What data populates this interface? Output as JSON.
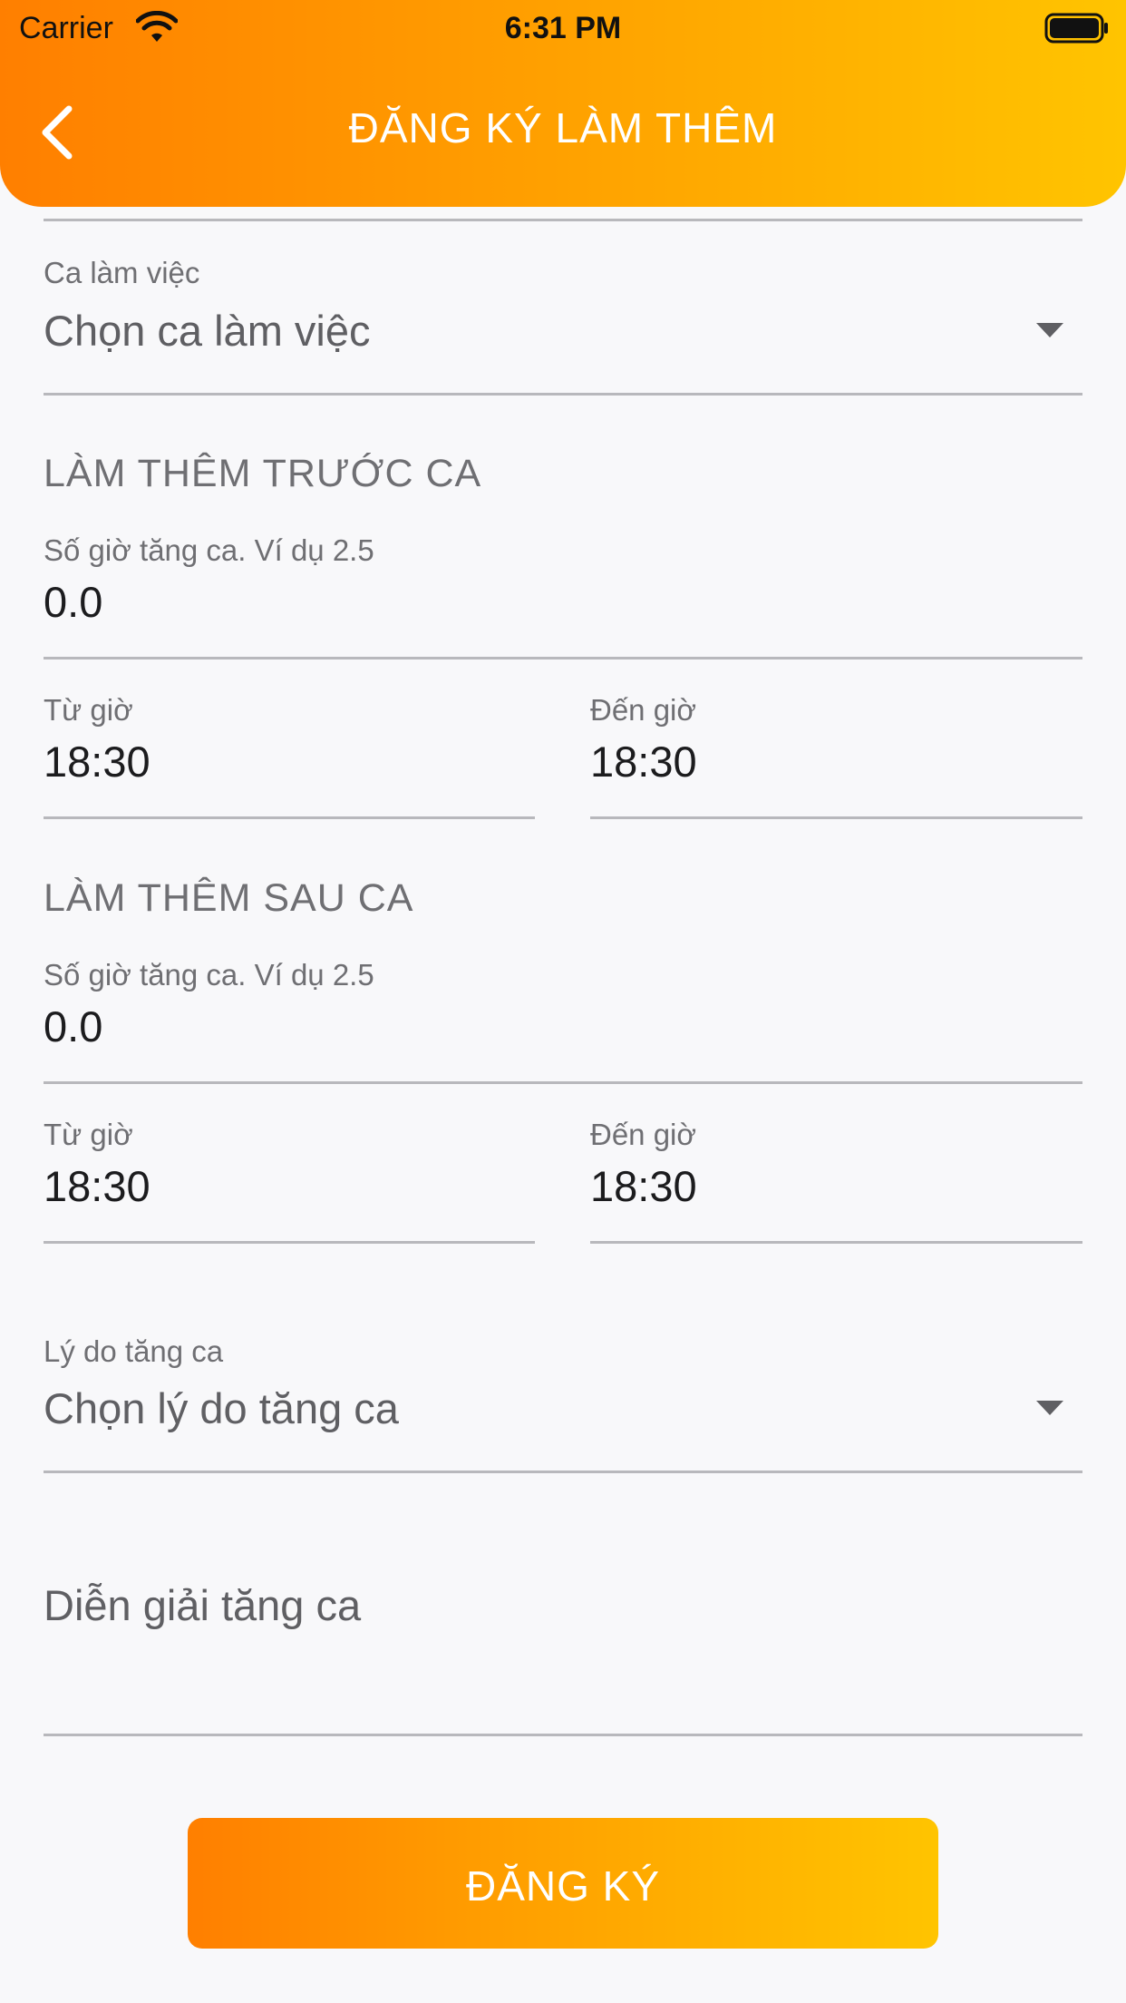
{
  "status_bar": {
    "carrier": "Carrier",
    "time": "6:31 PM"
  },
  "header": {
    "title": "ĐĂNG KÝ LÀM THÊM",
    "back_icon": "chevron-left-icon"
  },
  "shift": {
    "label": "Ca làm việc",
    "placeholder": "Chọn ca làm việc"
  },
  "before_shift": {
    "title": "LÀM THÊM TRƯỚC CA",
    "hours_label": "Số giờ tăng ca. Ví dụ 2.5",
    "hours_value": "0.0",
    "from_label": "Từ giờ",
    "from_value": "18:30",
    "to_label": "Đến giờ",
    "to_value": "18:30"
  },
  "after_shift": {
    "title": "LÀM THÊM SAU CA",
    "hours_label": "Số giờ tăng ca. Ví dụ 2.5",
    "hours_value": "0.0",
    "from_label": "Từ giờ",
    "from_value": "18:30",
    "to_label": "Đến giờ",
    "to_value": "18:30"
  },
  "reason": {
    "label": "Lý do tăng ca",
    "placeholder": "Chọn lý do tăng ca"
  },
  "description": {
    "placeholder": "Diễn giải tăng ca"
  },
  "submit": {
    "label": "ĐĂNG KÝ"
  },
  "colors": {
    "gradient_start": "#ff7f00",
    "gradient_end": "#ffc400",
    "background": "#f8f8fa",
    "divider": "#b8b8bc"
  }
}
